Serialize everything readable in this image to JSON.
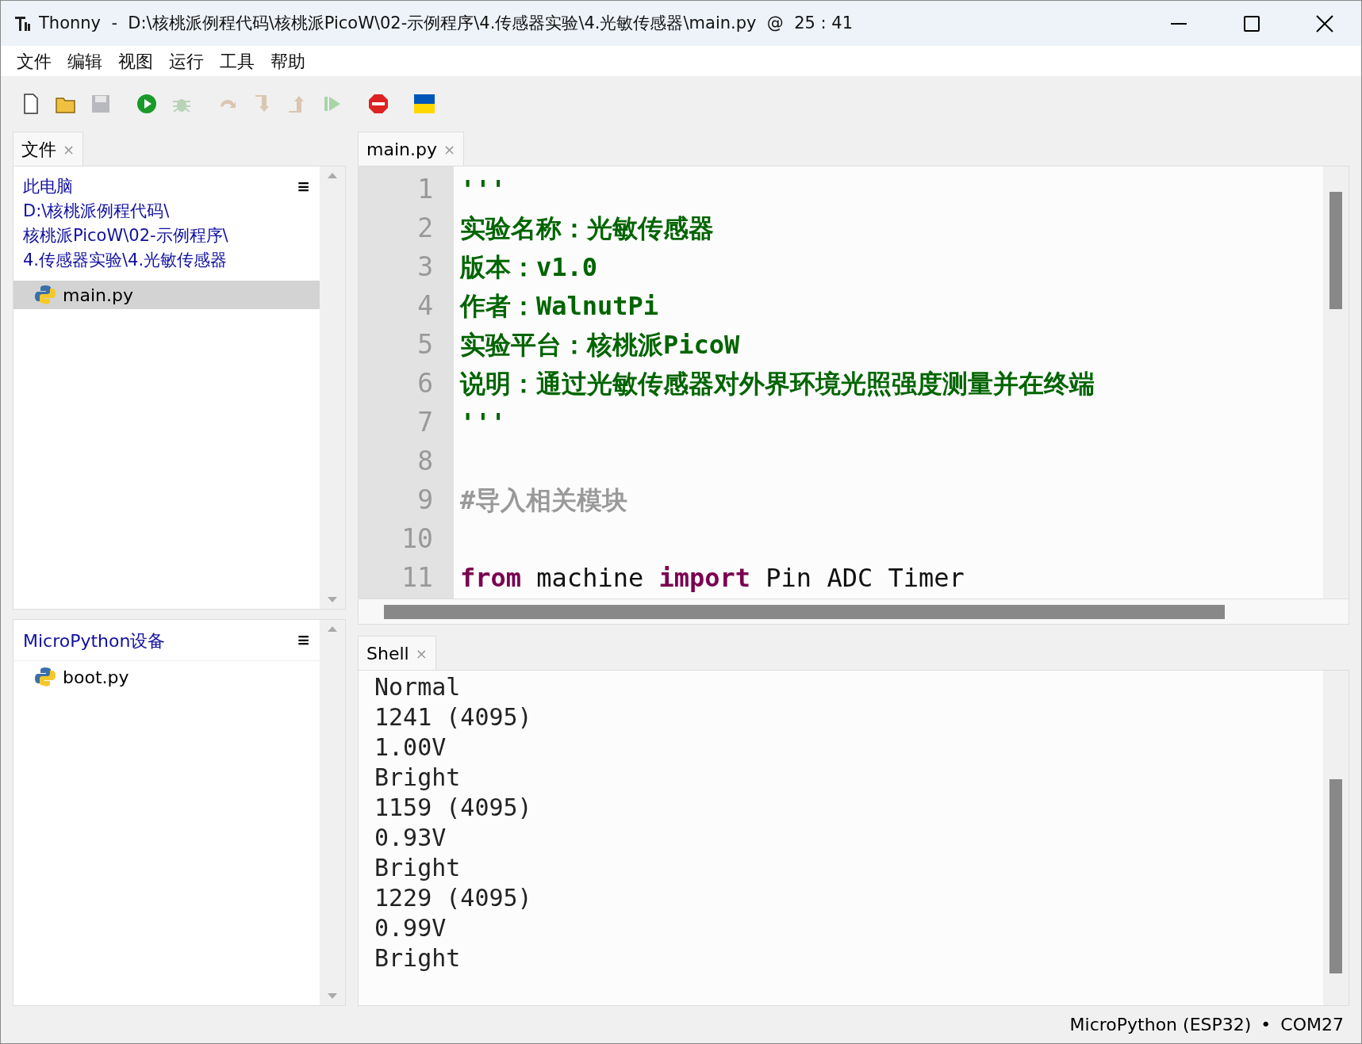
{
  "window": {
    "title": "Thonny  -  D:\\核桃派例程代码\\核桃派PicoW\\02-示例程序\\4.传感器实验\\4.光敏传感器\\main.py  @  25 : 41"
  },
  "menu": [
    "文件",
    "编辑",
    "视图",
    "运行",
    "工具",
    "帮助"
  ],
  "toolbar": [
    {
      "kind": "new",
      "disabled": false
    },
    {
      "kind": "open",
      "disabled": false
    },
    {
      "kind": "save",
      "disabled": true
    },
    {
      "kind": "run",
      "disabled": false
    },
    {
      "kind": "debug",
      "disabled": true
    },
    {
      "kind": "step-over",
      "disabled": true
    },
    {
      "kind": "step-into",
      "disabled": true
    },
    {
      "kind": "step-out",
      "disabled": true
    },
    {
      "kind": "resume",
      "disabled": true
    },
    {
      "kind": "stop",
      "disabled": false
    },
    {
      "kind": "flag",
      "disabled": false
    }
  ],
  "files_panel": {
    "tab": {
      "label": "文件",
      "close": "×",
      "selected": true
    },
    "menu_glyph": "≡",
    "location": [
      "此电脑",
      "D:\\核桃派例程代码\\",
      "核桃派PicoW\\02-示例程序\\",
      "4.传感器实验\\4.光敏传感器"
    ],
    "items": [
      {
        "name": "main.py",
        "selected": true
      }
    ]
  },
  "device_panel": {
    "title": "MicroPython设备",
    "menu_glyph": "≡",
    "items": [
      {
        "name": "boot.py",
        "selected": false
      }
    ]
  },
  "editor": {
    "tabs": [
      {
        "label": "main.py",
        "close": "×",
        "selected": true
      }
    ],
    "lines": [
      {
        "number": "1",
        "tokens": [
          {
            "kind": "string",
            "text": "'''"
          }
        ]
      },
      {
        "number": "2",
        "tokens": [
          {
            "kind": "string",
            "text": "实验名称：光敏传感器"
          }
        ]
      },
      {
        "number": "3",
        "tokens": [
          {
            "kind": "string",
            "text": "版本：v1.0"
          }
        ]
      },
      {
        "number": "4",
        "tokens": [
          {
            "kind": "string",
            "text": "作者：WalnutPi"
          }
        ]
      },
      {
        "number": "5",
        "tokens": [
          {
            "kind": "string",
            "text": "实验平台：核桃派PicoW"
          }
        ]
      },
      {
        "number": "6",
        "tokens": [
          {
            "kind": "string",
            "text": "说明：通过光敏传感器对外界环境光照强度测量并在终端"
          }
        ]
      },
      {
        "number": "7",
        "tokens": [
          {
            "kind": "string",
            "text": "'''"
          }
        ]
      },
      {
        "number": "8"
      },
      {
        "number": "9",
        "tokens": [
          {
            "kind": "comment",
            "text": "#导入相关模块"
          }
        ]
      },
      {
        "number": "10"
      },
      {
        "number": "11",
        "tokens": [
          {
            "kind": "keyword",
            "text": "from"
          },
          {
            "kind": "plain",
            "text": " machine "
          },
          {
            "kind": "keyword",
            "text": "import"
          },
          {
            "kind": "plain",
            "text": " Pin ADC Timer"
          }
        ]
      }
    ]
  },
  "shell": {
    "tab": {
      "label": "Shell",
      "close": "×",
      "selected": true
    },
    "lines": [
      "Normal",
      "1241 (4095)",
      "1.00V",
      "Bright",
      "1159 (4095)",
      "0.93V",
      "Bright",
      "1229 (4095)",
      "0.99V",
      "Bright"
    ]
  },
  "status_bar": {
    "interpreter": "MicroPython (ESP32)",
    "separator": "•",
    "port": "COM27"
  }
}
